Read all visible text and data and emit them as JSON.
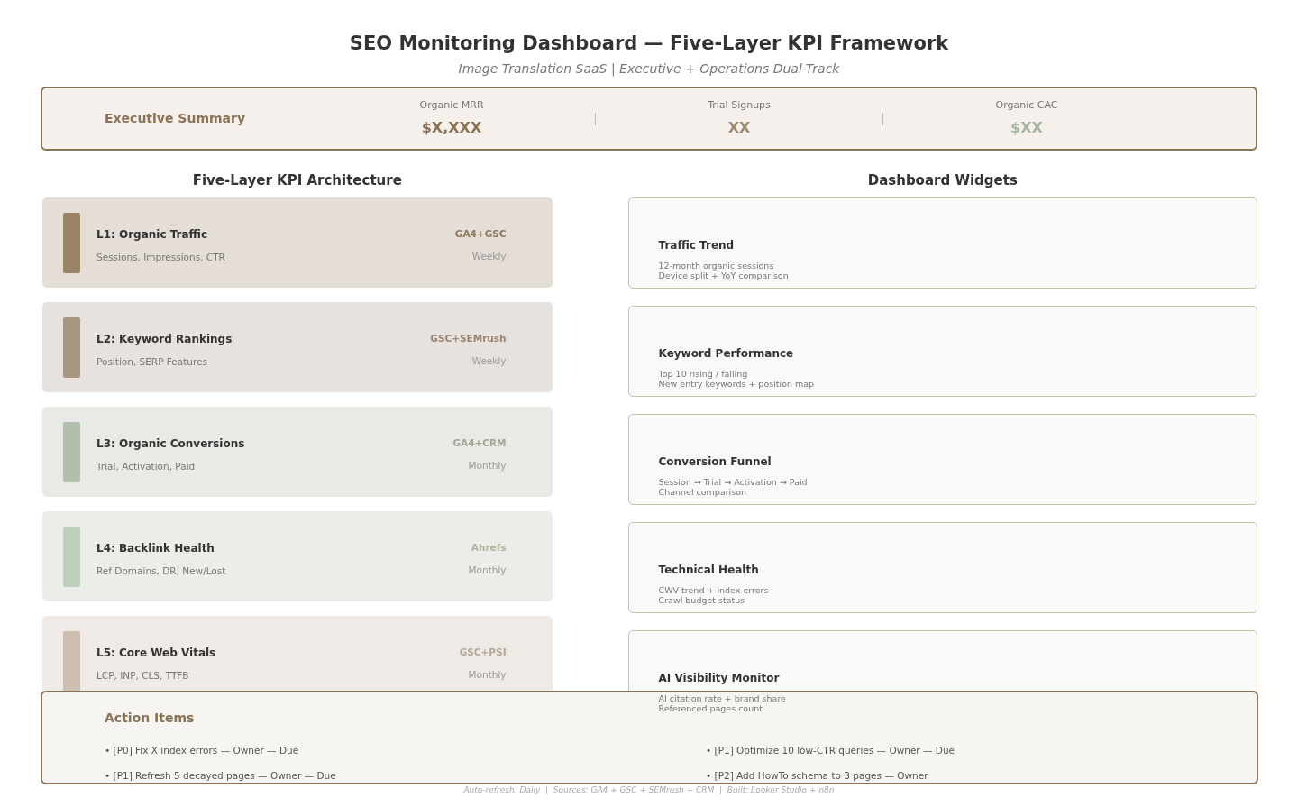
{
  "title": "SEO Monitoring Dashboard — Five-Layer KPI Framework",
  "subtitle": "Image Translation SaaS | Executive + Operations Dual-Track",
  "executive_summary": {
    "label": "Executive Summary",
    "metrics": [
      {
        "label": "Organic MRR",
        "value": "$X,XXX",
        "color": "#8b7355"
      },
      {
        "label": "Trial Signups",
        "value": "XX",
        "color": "#a08a74"
      },
      {
        "label": "Organic CAC",
        "value": "$XX",
        "color": "#a8b5a2"
      }
    ]
  },
  "kpi_architecture": {
    "heading": "Five-Layer KPI Architecture",
    "layers": [
      {
        "name": "L1: Organic Traffic",
        "metrics": "Sessions, Impressions, CTR",
        "source": "GA4+GSC",
        "frequency": "Weekly",
        "color": "#9a8466"
      },
      {
        "name": "L2: Keyword Rankings",
        "metrics": "Position, SERP Features",
        "source": "GSC+SEMrush",
        "frequency": "Weekly",
        "color": "#a89584"
      },
      {
        "name": "L3: Organic Conversions",
        "metrics": "Trial, Activation, Paid",
        "source": "GA4+CRM",
        "frequency": "Monthly",
        "color": "#b2bfad"
      },
      {
        "name": "L4: Backlink Health",
        "metrics": "Ref Domains, DR, New/Lost",
        "source": "Ahrefs",
        "frequency": "Monthly",
        "color": "#bfcfbc"
      },
      {
        "name": "L5: Core Web Vitals",
        "metrics": "LCP, INP, CLS, TTFB",
        "source": "GSC+PSI",
        "frequency": "Monthly",
        "color": "#cdbfb0"
      }
    ]
  },
  "dashboard_widgets": {
    "heading": "Dashboard Widgets",
    "widgets": [
      {
        "title": "Traffic Trend",
        "lines": [
          "12-month organic sessions",
          "Device split + YoY comparison"
        ]
      },
      {
        "title": "Keyword Performance",
        "lines": [
          "Top 10 rising / falling",
          "New entry keywords + position map"
        ]
      },
      {
        "title": "Conversion Funnel",
        "lines": [
          "Session → Trial → Activation → Paid",
          "Channel comparison"
        ]
      },
      {
        "title": "Technical Health",
        "lines": [
          "CWV trend + index errors",
          "Crawl budget status"
        ]
      },
      {
        "title": "AI Visibility Monitor",
        "lines": [
          "AI citation rate + brand share",
          "Referenced pages count"
        ]
      }
    ]
  },
  "action_items": {
    "heading": "Action Items",
    "items": [
      "• [P0] Fix X index errors — Owner — Due",
      "• [P1] Optimize 10 low-CTR queries — Owner — Due",
      "• [P1] Refresh 5 decayed pages — Owner — Due",
      "• [P2] Add HowTo schema to 3 pages — Owner"
    ]
  },
  "footer": "Auto-refresh: Daily  |  Sources: GA4 + GSC + SEMrush + CRM  |  Built: Looker Studio + n8n"
}
